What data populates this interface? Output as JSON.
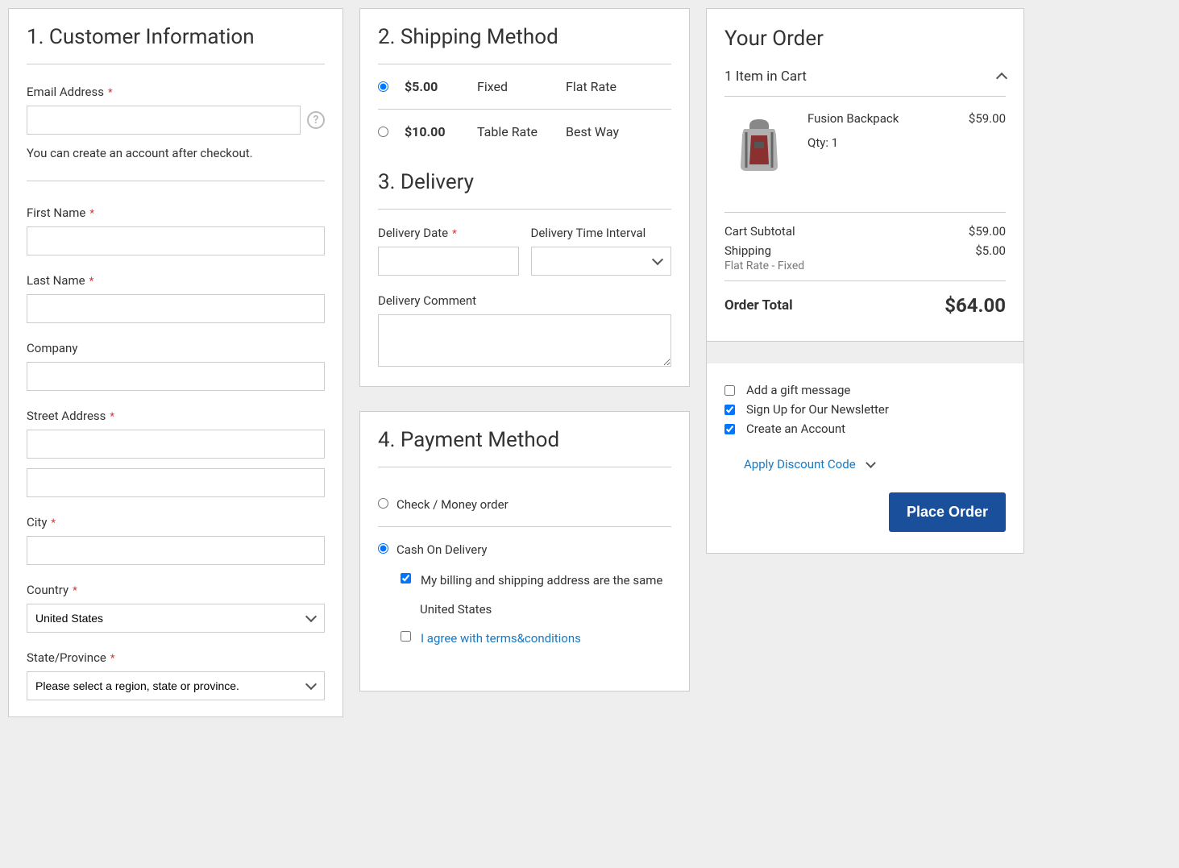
{
  "customer": {
    "heading": "1. Customer Information",
    "email_label": "Email Address",
    "email_value": "",
    "email_note": "You can create an account after checkout.",
    "first_name_label": "First Name",
    "first_name_value": "",
    "last_name_label": "Last Name",
    "last_name_value": "",
    "company_label": "Company",
    "company_value": "",
    "street_label": "Street Address",
    "street1_value": "",
    "street2_value": "",
    "city_label": "City",
    "city_value": "",
    "country_label": "Country",
    "country_value": "United States",
    "state_label": "State/Province",
    "state_value": "Please select a region, state or province."
  },
  "shipping": {
    "heading": "2. Shipping Method",
    "options": [
      {
        "price": "$5.00",
        "method": "Fixed",
        "carrier": "Flat Rate",
        "selected": true
      },
      {
        "price": "$10.00",
        "method": "Table Rate",
        "carrier": "Best Way",
        "selected": false
      }
    ]
  },
  "delivery": {
    "heading": "3. Delivery",
    "date_label": "Delivery Date",
    "date_value": "",
    "interval_label": "Delivery Time Interval",
    "interval_value": "",
    "comment_label": "Delivery Comment",
    "comment_value": ""
  },
  "payment": {
    "heading": "4. Payment Method",
    "options": [
      {
        "label": "Check / Money order",
        "selected": false
      },
      {
        "label": "Cash On Delivery",
        "selected": true
      }
    ],
    "billing_same_label": "My billing and shipping address are the same",
    "billing_same_checked": true,
    "billing_country": "United States",
    "terms_label": "I agree with terms&conditions",
    "terms_checked": false
  },
  "order": {
    "heading": "Your Order",
    "cart_count_label": "1 Item in Cart",
    "items": [
      {
        "name": "Fusion Backpack",
        "qty_label": "Qty: 1",
        "price": "$59.00"
      }
    ],
    "subtotal_label": "Cart Subtotal",
    "subtotal_value": "$59.00",
    "shipping_label": "Shipping",
    "shipping_sub": "Flat Rate - Fixed",
    "shipping_value": "$5.00",
    "total_label": "Order Total",
    "total_value": "$64.00",
    "gift_label": "Add a gift message",
    "gift_checked": false,
    "newsletter_label": "Sign Up for Our Newsletter",
    "newsletter_checked": true,
    "create_account_label": "Create an Account",
    "create_account_checked": true,
    "discount_label": "Apply Discount Code",
    "place_order_label": "Place Order"
  }
}
